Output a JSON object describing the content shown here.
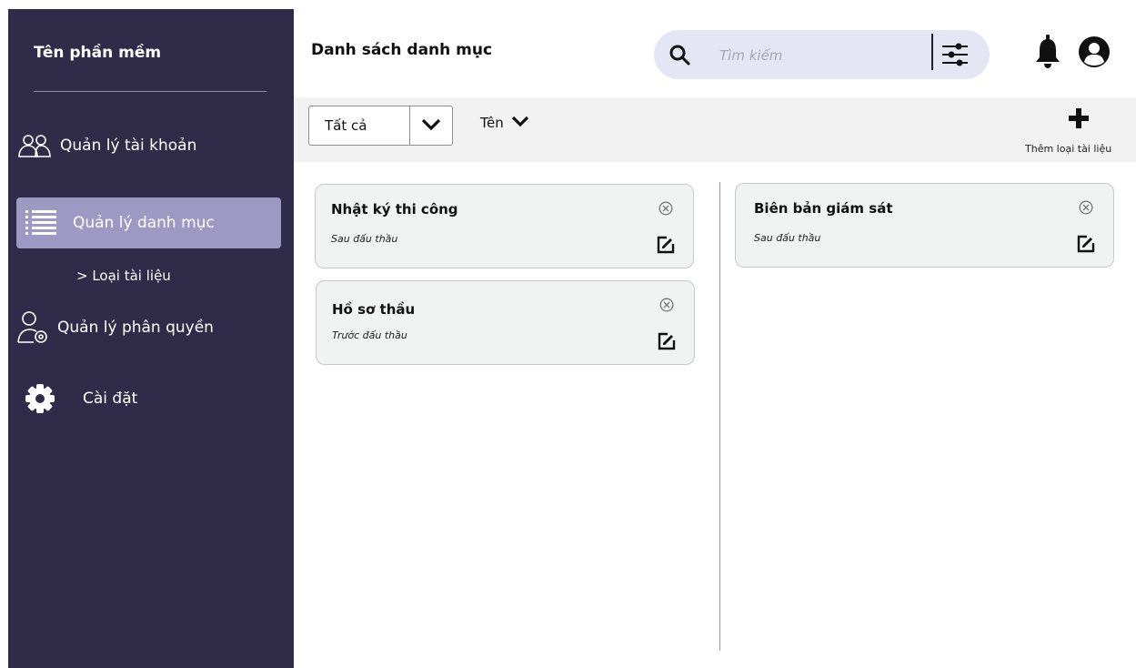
{
  "sidebar": {
    "brand": "Tên phần mềm",
    "items": [
      {
        "label": "Quản lý tài khoản",
        "icon": "users-icon"
      },
      {
        "label": "Quản lý danh mục",
        "icon": "list-icon",
        "active": true
      },
      {
        "label": "Quản lý phân quyền",
        "icon": "user-settings-icon"
      },
      {
        "label": "Cài đặt",
        "icon": "gear-icon"
      }
    ],
    "sub_item": "> Loại tài liệu"
  },
  "header": {
    "title": "Danh sách danh mục",
    "search_placeholder": "Tìm kiếm"
  },
  "toolbar": {
    "filter_value": "Tất cả",
    "sort_label": "Tên",
    "add_label": "Thêm loại tài liệu"
  },
  "cards": [
    {
      "title": "Nhật ký thi công",
      "subtitle": "Sau đấu thầu"
    },
    {
      "title": "Hồ sơ thầu",
      "subtitle": "Trước đấu thầu"
    },
    {
      "title": "Biên bản giám sát",
      "subtitle": "Sau đấu thầu"
    }
  ],
  "colors": {
    "sidebar": "#2f2b48",
    "active_item": "#9d99c3",
    "search_bg": "#e4e6f3",
    "toolbar_bg": "#f2f2f2"
  }
}
